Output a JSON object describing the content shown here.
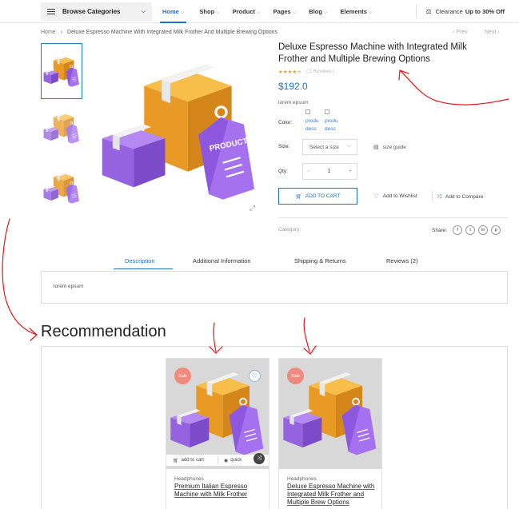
{
  "nav": {
    "browse_label": "Browse Categories",
    "items": [
      {
        "label": "Home"
      },
      {
        "label": "Shop"
      },
      {
        "label": "Product"
      },
      {
        "label": "Pages"
      },
      {
        "label": "Blog"
      },
      {
        "label": "Elements"
      }
    ],
    "clearance_text": "Clearance",
    "clearance_offer": "Up to 30% Off"
  },
  "breadcrumb": {
    "home": "Home",
    "current": "Deluxe Espresso Machine With Integrated Milk Frother And Multiple Brewing Options",
    "prev": "Prev",
    "next": "Next"
  },
  "product": {
    "title": "Deluxe Espresso Machine with Integrated Milk Frother and Multiple Brewing Options",
    "rating": 4,
    "reviews_text": "( 2 Reviews )",
    "price": "$192.0",
    "short_desc": "lorem epsum",
    "color_label": "Color:",
    "swatch_alt": [
      "produ",
      "desc"
    ],
    "size_label": "Size:",
    "size_placeholder": "Select a size",
    "size_guide": "size guide",
    "qty_label": "Qty:",
    "qty_value": "1",
    "qty_minus": "-",
    "qty_plus": "+",
    "add_to_cart": "ADD TO CART",
    "wishlist": "Add to Wishlist",
    "compare": "Add to Compare",
    "category_label": "Category:",
    "share_label": "Share:",
    "share_icons": [
      "f",
      "t",
      "in",
      "p"
    ]
  },
  "tabs": {
    "items": [
      {
        "label": "Description"
      },
      {
        "label": "Additional Information"
      },
      {
        "label": "Shipping & Returns"
      },
      {
        "label": "Reviews (2)"
      }
    ],
    "content": "lorem epsum"
  },
  "recommendation": {
    "title": "Recommendation",
    "cards": [
      {
        "badge": "Sale",
        "category": "Headphones",
        "name": "Premium Italian Espresso Machine with Milk Frother",
        "add_to_cart": "add to cart",
        "quick_view": "quick"
      },
      {
        "badge": "Sale",
        "category": "Headphones",
        "name": "Deluxe Espresso Machine with Integrated Milk Frother and Multiple Brew Options"
      }
    ]
  },
  "colors": {
    "accent": "#1d72c9",
    "box_orange": "#f0a22a",
    "box_purple": "#9a6ae8",
    "sale_badge": "#f08a7e",
    "annotation_red": "#e8141a"
  },
  "product_image_label": "PRODUCT"
}
